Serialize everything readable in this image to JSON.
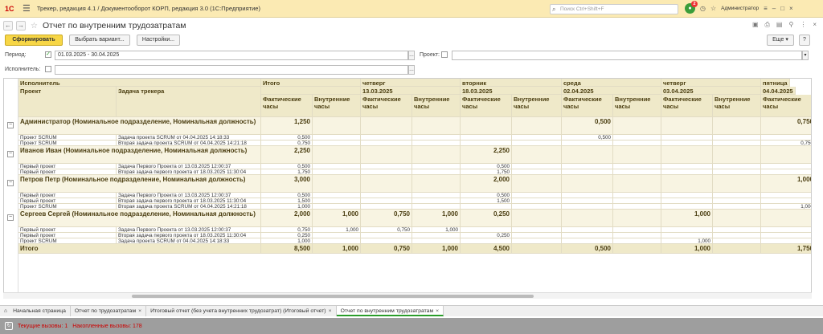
{
  "titlebar": {
    "logo": "1С",
    "title": "Трекер, редакция 4.1 / Документооборот КОРП, редакция 3.0 (1С:Предприятие)",
    "search_placeholder": "Поиск Ctrl+Shift+F",
    "notifications": "2",
    "user": "Администратор"
  },
  "header": {
    "title": "Отчет по внутренним трудозатратам"
  },
  "toolbar": {
    "generate": "Сформировать",
    "choose_variant": "Выбрать вариант...",
    "settings": "Настройки...",
    "more": "Еще",
    "help": "?"
  },
  "filters": {
    "period_label": "Период:",
    "period_value": "01.03.2025 - 30.04.2025",
    "project_label": "Проект:",
    "executor_label": "Исполнитель:"
  },
  "report": {
    "header": {
      "executor": "Исполнитель",
      "project": "Проект",
      "task": "Задача трекера",
      "total": "Итого",
      "fact": "Фактические часы",
      "internal": "Внутренние часы",
      "days": [
        {
          "weekday": "четверг",
          "date": "13.03.2025"
        },
        {
          "weekday": "вторник",
          "date": "18.03.2025"
        },
        {
          "weekday": "среда",
          "date": "02.04.2025"
        },
        {
          "weekday": "четверг",
          "date": "03.04.2025"
        },
        {
          "weekday": "пятница",
          "date": "04.04.2025"
        }
      ]
    },
    "groups": [
      {
        "name": "Администратор (Номинальное подразделение, Номинальная должность)",
        "total_fact": "1,250",
        "total_int": "",
        "days": [
          [
            "",
            ""
          ],
          [
            "",
            ""
          ],
          [
            "0,500",
            ""
          ],
          [
            "",
            ""
          ],
          [
            "0,750",
            ""
          ]
        ],
        "rows": [
          {
            "project": "Проект SCRUM",
            "task": "Задача проекта SCRUM от 04.04.2025 14:18:33",
            "total_fact": "0,500",
            "total_int": "",
            "days": [
              [
                "",
                ""
              ],
              [
                "",
                ""
              ],
              [
                "0,500",
                ""
              ],
              [
                "",
                ""
              ],
              [
                "",
                ""
              ]
            ]
          },
          {
            "project": "Проект SCRUM",
            "task": "Вторая задача проекта SCRUM от 04.04.2025 14:21:18",
            "total_fact": "0,750",
            "total_int": "",
            "days": [
              [
                "",
                ""
              ],
              [
                "",
                ""
              ],
              [
                "",
                ""
              ],
              [
                "",
                ""
              ],
              [
                "0,750",
                ""
              ]
            ]
          }
        ]
      },
      {
        "name": "Иванов Иван (Номинальное подразделение, Номинальная должность)",
        "total_fact": "2,250",
        "total_int": "",
        "days": [
          [
            "",
            ""
          ],
          [
            "2,250",
            ""
          ],
          [
            "",
            ""
          ],
          [
            "",
            ""
          ],
          [
            "",
            ""
          ]
        ],
        "rows": [
          {
            "project": "Первый проект",
            "task": "Задача Первого Проекта от 13.03.2025 12:00:37",
            "total_fact": "0,500",
            "total_int": "",
            "days": [
              [
                "",
                ""
              ],
              [
                "0,500",
                ""
              ],
              [
                "",
                ""
              ],
              [
                "",
                ""
              ],
              [
                "",
                ""
              ]
            ]
          },
          {
            "project": "Первый проект",
            "task": "Вторая задача первого проекта от 18.03.2025 11:30:04",
            "total_fact": "1,750",
            "total_int": "",
            "days": [
              [
                "",
                ""
              ],
              [
                "1,750",
                ""
              ],
              [
                "",
                ""
              ],
              [
                "",
                ""
              ],
              [
                "",
                ""
              ]
            ]
          }
        ]
      },
      {
        "name": "Петров Петр (Номинальное подразделение, Номинальная должность)",
        "total_fact": "3,000",
        "total_int": "",
        "days": [
          [
            "",
            ""
          ],
          [
            "2,000",
            ""
          ],
          [
            "",
            ""
          ],
          [
            "",
            ""
          ],
          [
            "1,000",
            ""
          ]
        ],
        "rows": [
          {
            "project": "Первый проект",
            "task": "Задача Первого Проекта от 13.03.2025 12:00:37",
            "total_fact": "0,500",
            "total_int": "",
            "days": [
              [
                "",
                ""
              ],
              [
                "0,500",
                ""
              ],
              [
                "",
                ""
              ],
              [
                "",
                ""
              ],
              [
                "",
                ""
              ]
            ]
          },
          {
            "project": "Первый проект",
            "task": "Вторая задача первого проекта от 18.03.2025 11:30:04",
            "total_fact": "1,500",
            "total_int": "",
            "days": [
              [
                "",
                ""
              ],
              [
                "1,500",
                ""
              ],
              [
                "",
                ""
              ],
              [
                "",
                ""
              ],
              [
                "",
                ""
              ]
            ]
          },
          {
            "project": "Проект SCRUM",
            "task": "Вторая задача проекта SCRUM от 04.04.2025 14:21:18",
            "total_fact": "1,000",
            "total_int": "",
            "days": [
              [
                "",
                ""
              ],
              [
                "",
                ""
              ],
              [
                "",
                ""
              ],
              [
                "",
                ""
              ],
              [
                "1,000",
                ""
              ]
            ]
          }
        ]
      },
      {
        "name": "Сергеев Сергей (Номинальное подразделение, Номинальная должность)",
        "total_fact": "2,000",
        "total_int": "1,000",
        "days": [
          [
            "0,750",
            "1,000"
          ],
          [
            "0,250",
            ""
          ],
          [
            "",
            ""
          ],
          [
            "1,000",
            ""
          ],
          [
            "",
            ""
          ]
        ],
        "rows": [
          {
            "project": "Первый проект",
            "task": "Задача Первого Проекта от 13.03.2025 12:00:37",
            "total_fact": "0,750",
            "total_int": "1,000",
            "days": [
              [
                "0,750",
                "1,000"
              ],
              [
                "",
                ""
              ],
              [
                "",
                ""
              ],
              [
                "",
                ""
              ],
              [
                "",
                ""
              ]
            ]
          },
          {
            "project": "Первый проект",
            "task": "Вторая задача первого проекта от 18.03.2025 11:30:04",
            "total_fact": "0,250",
            "total_int": "",
            "days": [
              [
                "",
                ""
              ],
              [
                "0,250",
                ""
              ],
              [
                "",
                ""
              ],
              [
                "",
                ""
              ],
              [
                "",
                ""
              ]
            ]
          },
          {
            "project": "Проект SCRUM",
            "task": "Задача проекта SCRUM от 04.04.2025 14:18:33",
            "total_fact": "1,000",
            "total_int": "",
            "days": [
              [
                "",
                ""
              ],
              [
                "",
                ""
              ],
              [
                "",
                ""
              ],
              [
                "1,000",
                ""
              ],
              [
                "",
                ""
              ]
            ]
          }
        ]
      }
    ],
    "total": {
      "label": "Итого",
      "total_fact": "8,500",
      "total_int": "1,000",
      "days": [
        [
          "0,750",
          "1,000"
        ],
        [
          "4,500",
          ""
        ],
        [
          "0,500",
          ""
        ],
        [
          "1,000",
          ""
        ],
        [
          "1,750",
          ""
        ]
      ]
    }
  },
  "tabs": [
    {
      "label": "Начальная страница",
      "closable": false
    },
    {
      "label": "Отчет по трудозатратам",
      "closable": true
    },
    {
      "label": "Итоговый отчет (без учета внутренних трудозатрат) (Итоговый отчет)",
      "closable": true
    },
    {
      "label": "Отчет по внутренним трудозатратам",
      "closable": true,
      "active": true
    }
  ],
  "status": {
    "current_calls": "Текущие вызовы: 1",
    "accumulated_calls": "Накопленные вызовы: 178"
  }
}
